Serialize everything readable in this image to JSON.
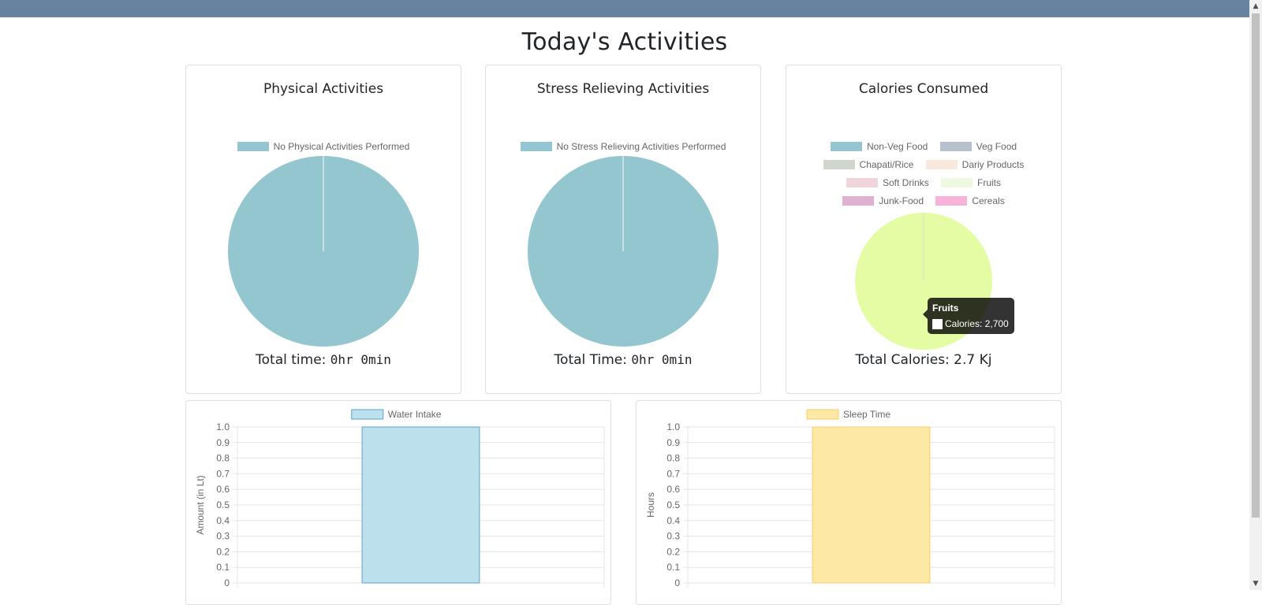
{
  "page": {
    "title": "Today's Activities"
  },
  "physical": {
    "title": "Physical Activities",
    "legend": [
      "No Physical Activities Performed"
    ],
    "footer_label": "Total time: ",
    "footer_value": "0hr 0min"
  },
  "stress": {
    "title": "Stress Relieving Activities",
    "legend": [
      "No Stress Relieving  Activities Performed"
    ],
    "footer_label": "Total Time: ",
    "footer_value": "0hr 0min"
  },
  "calories": {
    "title": "Calories Consumed",
    "legend": [
      "Non-Veg Food",
      "Veg Food",
      "Chapati/Rice",
      "Dariy Products",
      "Soft Drinks",
      "Fruits",
      "Junk-Food",
      "Cereals"
    ],
    "footer": "Total Calories: 2.7 Kj",
    "tooltip": {
      "title": "Fruits",
      "body": "Calories: 2,700"
    }
  },
  "colors": {
    "pie_teal": "#93c6ce",
    "fruits": "#e4fda4",
    "water_fill": "#bce1ec",
    "water_border": "#5aa2c9",
    "sleep_fill": "#fee8a6",
    "sleep_border": "#f5cf6b",
    "legend_swatches": [
      "#93c6ce",
      "#b7c1ce",
      "#d0d5cd",
      "#f8e9dc",
      "#f0d5dc",
      "#eff8e0",
      "#dfb0d2",
      "#f7b2d9"
    ]
  },
  "chart_data": [
    {
      "type": "pie",
      "categories": [
        "No Physical Activities Performed"
      ],
      "values": [
        1
      ]
    },
    {
      "type": "pie",
      "categories": [
        "No Stress Relieving  Activities Performed"
      ],
      "values": [
        1
      ]
    },
    {
      "type": "pie",
      "categories": [
        "Non-Veg Food",
        "Veg Food",
        "Chapati/Rice",
        "Dariy Products",
        "Soft Drinks",
        "Fruits",
        "Junk-Food",
        "Cereals"
      ],
      "values": [
        0,
        0,
        0,
        0,
        0,
        2700,
        0,
        0
      ]
    },
    {
      "type": "bar",
      "series": [
        {
          "name": "Water Intake",
          "values": [
            1
          ]
        }
      ],
      "ylabel": "Amount (in Lt)",
      "ylim": [
        0,
        1.0
      ],
      "yticks": [
        "1.0",
        "0.9",
        "0.8",
        "0.7",
        "0.6",
        "0.5",
        "0.4",
        "0.3",
        "0.2",
        "0.1",
        "0"
      ],
      "grid": true,
      "legend": "top"
    },
    {
      "type": "bar",
      "series": [
        {
          "name": "Sleep Time",
          "values": [
            1
          ]
        }
      ],
      "ylabel": "Hours",
      "ylim": [
        0,
        1.0
      ],
      "yticks": [
        "1.0",
        "0.9",
        "0.8",
        "0.7",
        "0.6",
        "0.5",
        "0.4",
        "0.3",
        "0.2",
        "0.1",
        "0"
      ],
      "grid": true,
      "legend": "top"
    }
  ]
}
